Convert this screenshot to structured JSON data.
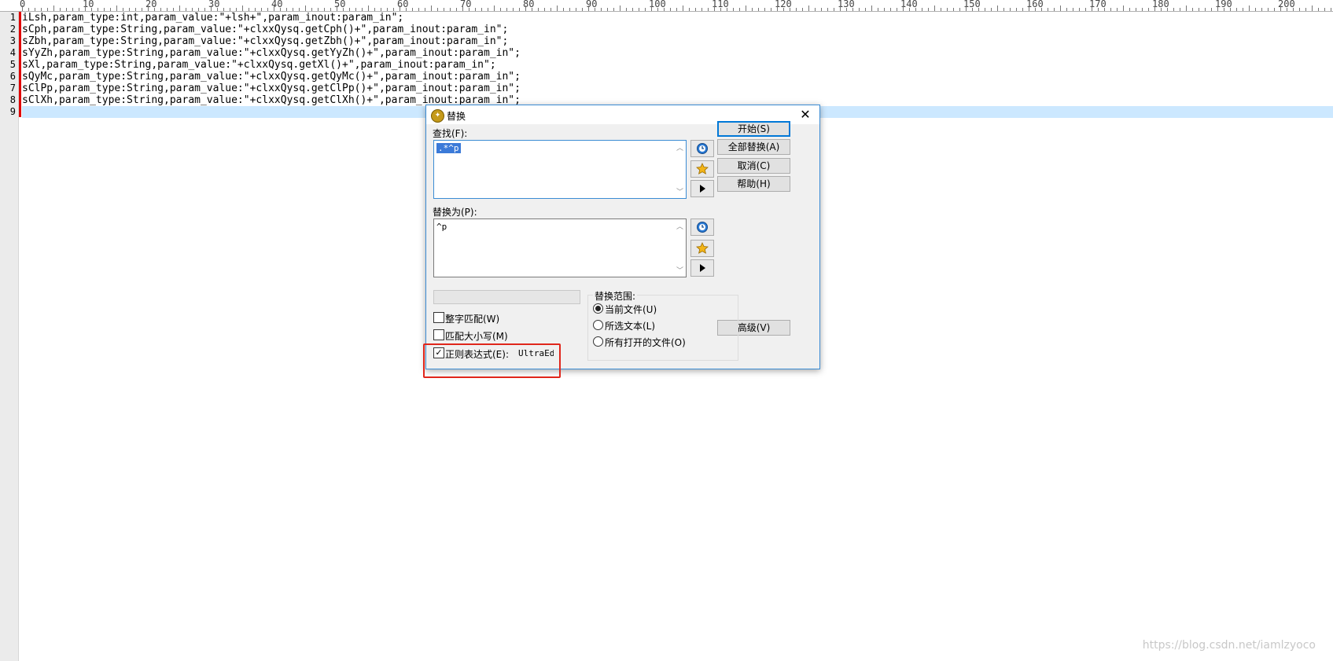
{
  "ruler": {
    "labels": [
      "0",
      "10",
      "20",
      "30",
      "40",
      "50",
      "60",
      "70",
      "80",
      "90",
      "100",
      "110",
      "120",
      "130",
      "140",
      "150",
      "160",
      "170",
      "180",
      "190",
      "200"
    ]
  },
  "editor": {
    "line_numbers": [
      "1",
      "2",
      "3",
      "4",
      "5",
      "6",
      "7",
      "8",
      "9"
    ],
    "lines": [
      "iLsh,param_type:int,param_value:\"+lsh+\",param_inout:param_in\";",
      "sCph,param_type:String,param_value:\"+clxxQysq.getCph()+\",param_inout:param_in\";",
      "sZbh,param_type:String,param_value:\"+clxxQysq.getZbh()+\",param_inout:param_in\";",
      "sYyZh,param_type:String,param_value:\"+clxxQysq.getYyZh()+\",param_inout:param_in\";",
      "sXl,param_type:String,param_value:\"+clxxQysq.getXl()+\",param_inout:param_in\";",
      "sQyMc,param_type:String,param_value:\"+clxxQysq.getQyMc()+\",param_inout:param_in\";",
      "sClPp,param_type:String,param_value:\"+clxxQysq.getClPp()+\",param_inout:param_in\";",
      "sClXh,param_type:String,param_value:\"+clxxQysq.getClXh()+\",param_inout:param_in\";",
      ""
    ],
    "current_line": 9
  },
  "dialog": {
    "title": "替换",
    "find_label": "查找(F):",
    "find_value": ".*^p",
    "replace_label": "替换为(P):",
    "replace_value": "^p",
    "buttons": {
      "start": "开始(S)",
      "replace_all": "全部替换(A)",
      "cancel": "取消(C)",
      "help": "帮助(H)",
      "advanced": "高级(V)"
    },
    "options": {
      "whole_word": {
        "label": "整字匹配(W)",
        "checked": false
      },
      "match_case": {
        "label": "匹配大小写(M)",
        "checked": false
      },
      "regex": {
        "label": "正则表达式(E):",
        "checked": true,
        "engine": "UltraEdit"
      }
    },
    "scope": {
      "title": "替换范围:",
      "items": [
        {
          "label": "当前文件(U)",
          "selected": true
        },
        {
          "label": "所选文本(L)",
          "selected": false
        },
        {
          "label": "所有打开的文件(O)",
          "selected": false
        }
      ]
    },
    "icons": {
      "history": "history-clock-icon",
      "favorite": "favorite-star-icon",
      "expand": "expand-arrow-icon"
    }
  },
  "colors": {
    "highlight_box": "#e0261b",
    "line_marker": "#e00000",
    "current_line": "#cce8ff",
    "selection": "#3b7ad8"
  },
  "watermark": "https://blog.csdn.net/iamlzyoco"
}
